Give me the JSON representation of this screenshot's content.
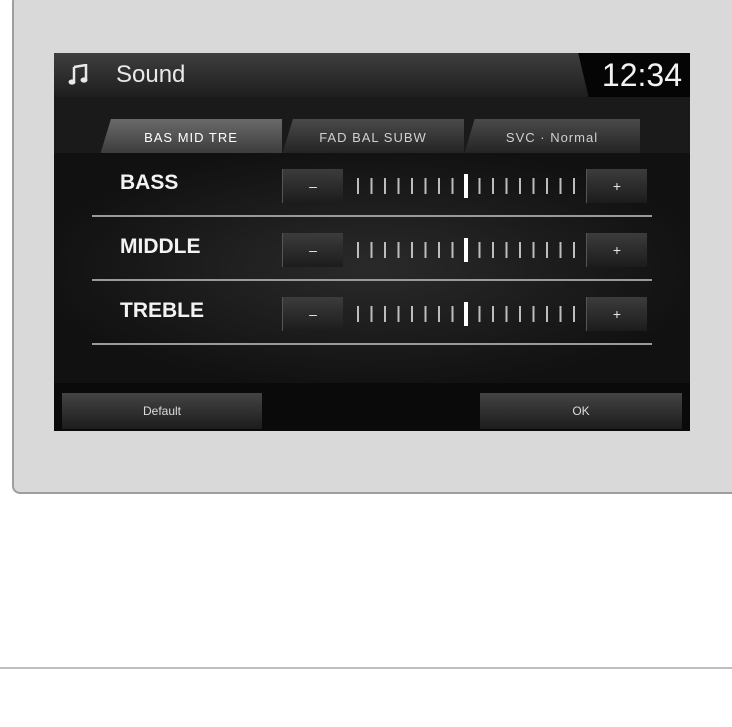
{
  "header": {
    "title": "Sound",
    "clock": "12:34",
    "icon": "music-note-icon"
  },
  "tabs": [
    {
      "label": "BAS MID TRE",
      "active": true
    },
    {
      "label": "FAD BAL SUBW",
      "active": false
    },
    {
      "label": "SVC · Normal",
      "active": false
    }
  ],
  "controls": [
    {
      "label": "BASS",
      "level": 0
    },
    {
      "label": "MIDDLE",
      "level": 0
    },
    {
      "label": "TREBLE",
      "level": 0
    }
  ],
  "buttons": {
    "minus": "–",
    "plus": "+",
    "default": "Default",
    "ok": "OK"
  },
  "scale": {
    "ticks": 17,
    "center_index": 8,
    "range": [
      -6,
      6
    ]
  },
  "colors": {
    "screen": "#0d0d0d",
    "bezel": "#d9d9d9",
    "text": "#f3f3f3"
  }
}
